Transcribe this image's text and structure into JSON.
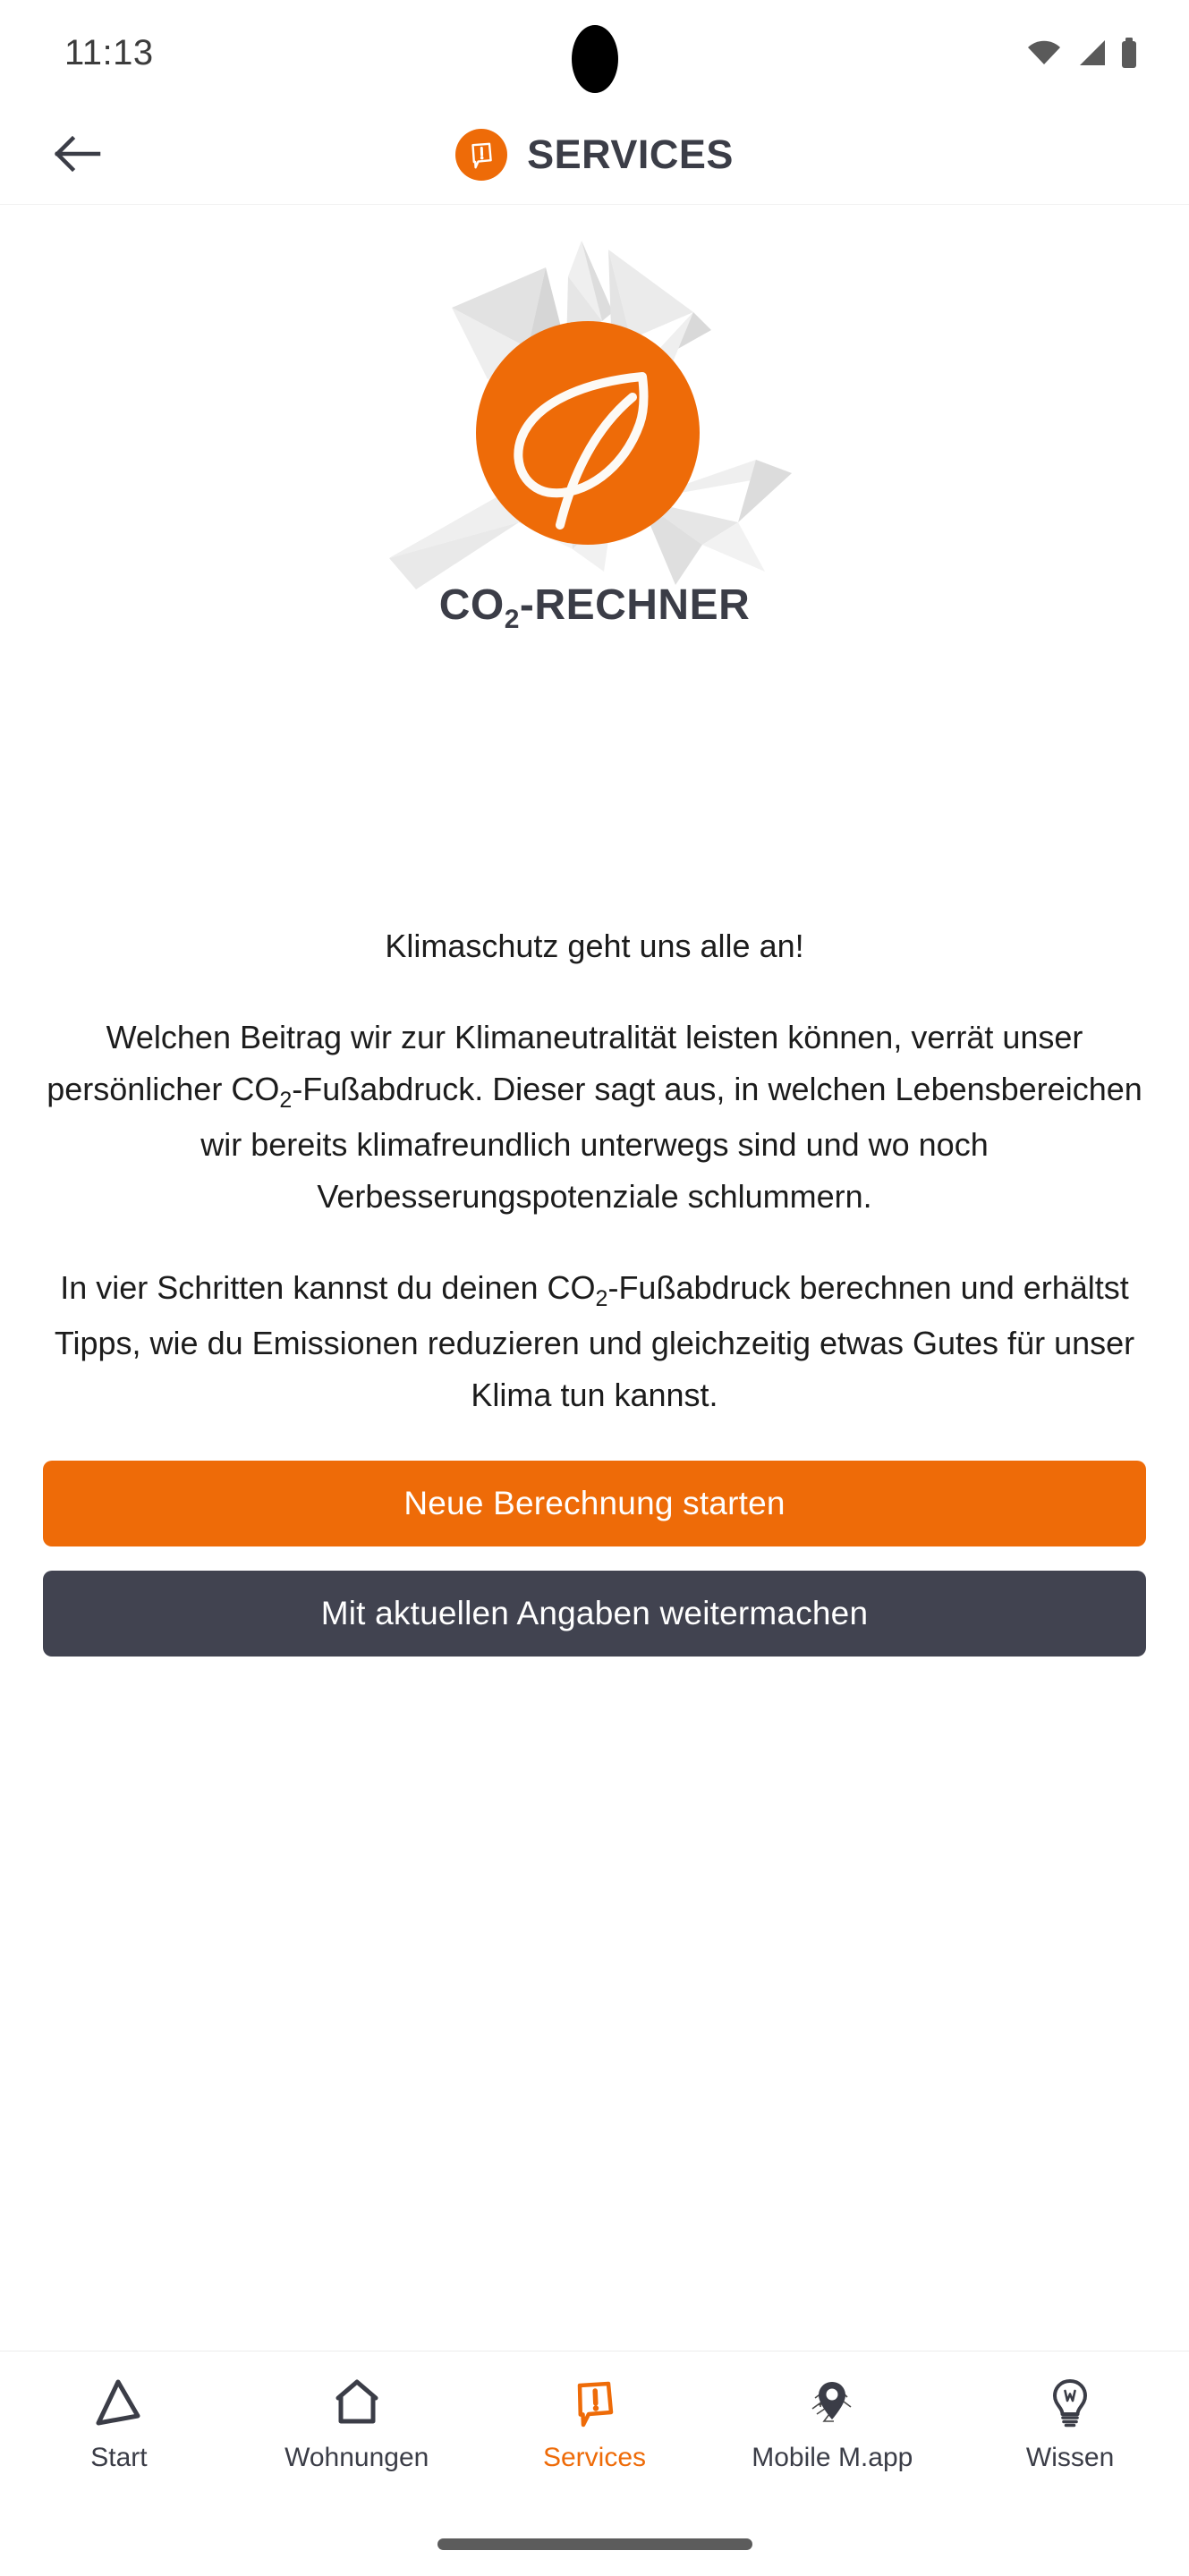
{
  "status_bar": {
    "time": "11:13",
    "icons": [
      "wifi-icon",
      "cellular-signal-icon",
      "battery-icon"
    ]
  },
  "header": {
    "back_label": "back-arrow",
    "logo": "services-speech-bubble-icon",
    "title": "SERVICES"
  },
  "hero": {
    "illustration": "co2-leaf-burst-illustration",
    "caption_main": "CO",
    "caption_sub": "2",
    "caption_rest": "-RECHNER"
  },
  "body": {
    "paragraph1": "Klimaschutz geht uns alle an!",
    "paragraph2_a": "Welchen Beitrag wir zur Klimaneutralität leisten können, verrät unser persönlicher CO",
    "paragraph2_sub": "2",
    "paragraph2_b": "-Fußabdruck. Dieser sagt aus, in welchen Lebensbereichen wir bereits klimafreundlich unterwegs sind und wo noch Verbesserungspotenziale schlummern.",
    "paragraph3_a": "In vier Schritten kannst du deinen CO",
    "paragraph3_sub": "2",
    "paragraph3_b": "-Fußabdruck berechnen und erhältst Tipps, wie du Emissionen reduzieren und gleichzeitig etwas Gutes für unser Klima tun kannst."
  },
  "actions": {
    "primary_label": "Neue Berechnung starten",
    "secondary_label": "Mit aktuellen Angaben weitermachen"
  },
  "bottom_nav": {
    "items": [
      {
        "label": "Start",
        "icon": "triangle-arrow-icon",
        "active": false
      },
      {
        "label": "Wohnungen",
        "icon": "house-icon",
        "active": false
      },
      {
        "label": "Services",
        "icon": "speech-bubble-exclamation-icon",
        "active": true
      },
      {
        "label": "Mobile M.app",
        "icon": "map-pin-icon",
        "active": false
      },
      {
        "label": "Wissen",
        "icon": "lightbulb-w-icon",
        "active": false
      }
    ]
  },
  "colors": {
    "accent_orange": "#ee6b08",
    "dark_charcoal": "#414350",
    "text_dark": "#1c1c1c",
    "nav_inactive": "#3b3d47"
  }
}
